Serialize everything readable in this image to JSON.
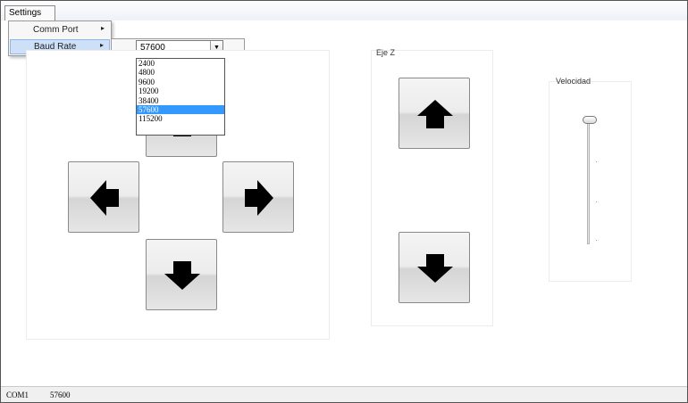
{
  "menu": {
    "settings_label": "Settings",
    "items": [
      {
        "label": "Comm Port",
        "arrow": "▸"
      },
      {
        "label": "Baud Rate",
        "arrow": "▸"
      }
    ]
  },
  "baud_rate": {
    "selected": "57600",
    "options": [
      "2400",
      "4800",
      "9600",
      "19200",
      "38400",
      "57600",
      "115200"
    ],
    "dropdown_icon": "▼"
  },
  "axis_z": {
    "label": "Eje Z"
  },
  "speed": {
    "label": "Velocidad",
    "level": 1.0
  },
  "icons": {
    "left": "arrow-left-icon",
    "right": "arrow-right-icon",
    "down": "arrow-down-icon",
    "z_up": "arrow-up-icon",
    "z_down": "arrow-down-icon"
  },
  "status": {
    "port": "COM1",
    "baud": "57600"
  },
  "colors": {
    "selection": "#3399ff",
    "menu_highlight": "#cde0f7"
  }
}
